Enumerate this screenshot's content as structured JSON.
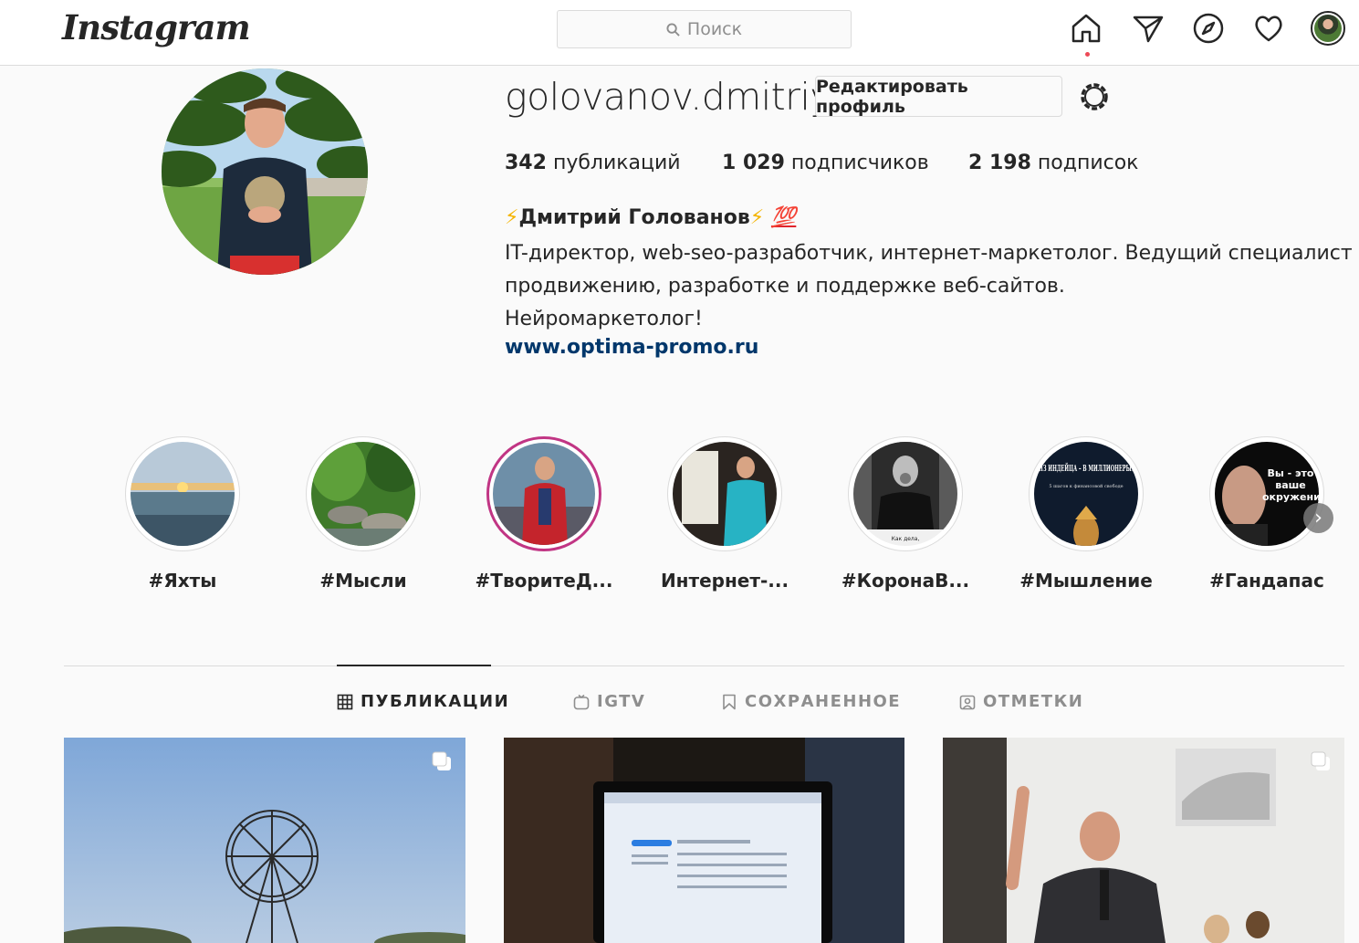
{
  "nav": {
    "logo": "Instagram",
    "search_placeholder": "Поиск",
    "icons": [
      "home-icon",
      "direct-icon",
      "explore-icon",
      "activity-icon",
      "profile-avatar"
    ]
  },
  "profile": {
    "username": "golovanov.dmitriy",
    "edit_button": "Редактировать профиль",
    "stats": {
      "posts_num": "342",
      "posts_label": "публикаций",
      "followers_num": "1 029",
      "followers_label": "подписчиков",
      "following_num": "2 198",
      "following_label": "подписок"
    },
    "full_name": "Дмитрий Голованов",
    "name_emoji_left": "⚡",
    "name_emoji_right": "⚡",
    "name_emoji_hundred": "💯",
    "bio_lines": [
      "IT-директор, web-seo-разработчик, интернет-маркетолог. Ведущий специалист по",
      "продвижению, разработке и поддержке веб-сайтов.",
      "Нейромаркетолог!"
    ],
    "website": "www.optima-promo.ru"
  },
  "highlights": [
    {
      "label": "#Яхты"
    },
    {
      "label": "#Мысли"
    },
    {
      "label": "#ТворитеД..."
    },
    {
      "label": "Интернет-..."
    },
    {
      "label": "#КоронаВ...",
      "caption": "Как дела,"
    },
    {
      "label": "#Мышление",
      "title": "ИЗ ИНДЕЙЦА – В МИЛЛИОНЕРЫ!",
      "subtitle": "5 шагов к финансовой свободе"
    },
    {
      "label": "#Гандапас",
      "title": "Вы - это ваше окружение"
    }
  ],
  "tabs": [
    {
      "label": "ПУБЛИКАЦИИ",
      "active": true
    },
    {
      "label": "IGTV",
      "active": false
    },
    {
      "label": "СОХРАНЕННОЕ",
      "active": false
    },
    {
      "label": "ОТМЕТКИ",
      "active": false
    }
  ],
  "colors": {
    "background": "#fafafa",
    "border": "#dbdbdb",
    "text": "#262626",
    "muted": "#8e8e8e",
    "link": "#00376b",
    "notification": "#ed4956"
  }
}
